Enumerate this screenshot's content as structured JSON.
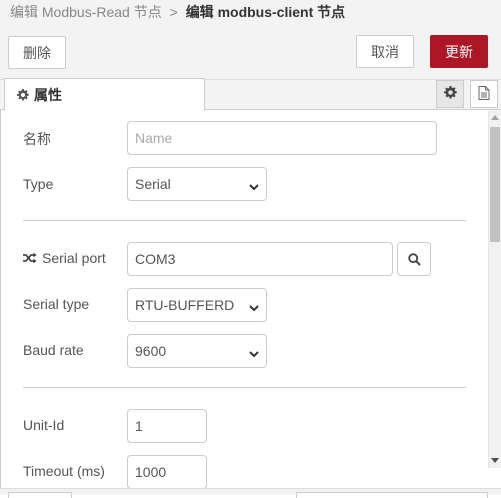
{
  "breadcrumb": {
    "parent": "编辑 Modbus-Read 节点",
    "separator": ">",
    "current": "编辑 modbus-client 节点"
  },
  "toolbar": {
    "delete_label": "删除",
    "cancel_label": "取消",
    "update_label": "更新"
  },
  "tabs": {
    "properties_label": "属性"
  },
  "form": {
    "name": {
      "label": "名称",
      "value": "",
      "placeholder": "Name"
    },
    "type": {
      "label": "Type",
      "value": "Serial"
    },
    "serial_port": {
      "label": "Serial port",
      "value": "COM3"
    },
    "serial_type": {
      "label": "Serial type",
      "value": "RTU-BUFFERD"
    },
    "baud_rate": {
      "label": "Baud rate",
      "value": "9600"
    },
    "unit_id": {
      "label": "Unit-Id",
      "value": "1"
    },
    "timeout": {
      "label": "Timeout (ms)",
      "value": "1000"
    }
  },
  "colors": {
    "accent": "#ad1625",
    "panel_bg": "#f3f3f3",
    "border": "#cccccc"
  },
  "icons": {
    "gear": "gear-icon",
    "document": "document-icon",
    "shuffle": "shuffle-icon",
    "search": "search-icon",
    "chevron": "chevron-down-icon"
  }
}
